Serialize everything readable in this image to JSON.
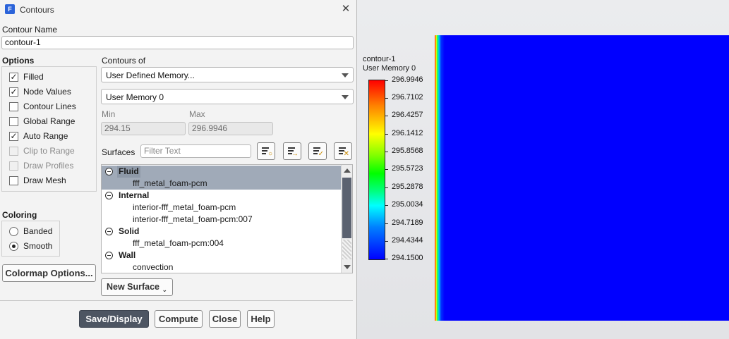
{
  "window": {
    "title": "Contours",
    "app_icon": "F"
  },
  "contour_name": {
    "label": "Contour Name",
    "value": "contour-1"
  },
  "options": {
    "title": "Options",
    "items": [
      {
        "label": "Filled",
        "checked": true,
        "enabled": true
      },
      {
        "label": "Node Values",
        "checked": true,
        "enabled": true
      },
      {
        "label": "Contour Lines",
        "checked": false,
        "enabled": true
      },
      {
        "label": "Global Range",
        "checked": false,
        "enabled": true
      },
      {
        "label": "Auto Range",
        "checked": true,
        "enabled": true
      },
      {
        "label": "Clip to Range",
        "checked": false,
        "enabled": false
      },
      {
        "label": "Draw Profiles",
        "checked": false,
        "enabled": false
      },
      {
        "label": "Draw Mesh",
        "checked": false,
        "enabled": true
      }
    ]
  },
  "contours_of": {
    "label": "Contours of",
    "primary": "User Defined Memory...",
    "secondary": "User Memory 0",
    "min_label": "Min",
    "max_label": "Max",
    "min_value": "294.15",
    "max_value": "296.9946"
  },
  "surfaces": {
    "label": "Surfaces",
    "filter_placeholder": "Filter Text",
    "groups": [
      {
        "name": "Fluid",
        "items": [
          "fff_metal_foam-pcm"
        ]
      },
      {
        "name": "Internal",
        "items": [
          "interior-fff_metal_foam-pcm",
          "interior-fff_metal_foam-pcm:007"
        ]
      },
      {
        "name": "Solid",
        "items": [
          "fff_metal_foam-pcm:004"
        ]
      },
      {
        "name": "Wall",
        "items": [
          "convection"
        ]
      }
    ]
  },
  "coloring": {
    "title": "Coloring",
    "options": [
      "Banded",
      "Smooth"
    ],
    "selected": "Smooth"
  },
  "buttons": {
    "colormap_options": "Colormap Options...",
    "new_surface": "New Surface",
    "save_display": "Save/Display",
    "compute": "Compute",
    "close": "Close",
    "help": "Help"
  },
  "icons": {
    "close": "close-icon",
    "surface_tools": [
      "select-surface-icon",
      "group-surfaces-icon",
      "select-all-icon",
      "deselect-all-icon"
    ]
  },
  "legend": {
    "name": "contour-1",
    "variable": "User Memory 0",
    "ticks": [
      "296.9946",
      "296.7102",
      "296.4257",
      "296.1412",
      "295.8568",
      "295.5723",
      "295.2878",
      "295.0034",
      "294.7189",
      "294.4344",
      "294.1500"
    ]
  },
  "colors": {
    "primary_button": "#4d5562",
    "selection": "#a0aab8",
    "field_low": "#0000ff",
    "field_high": "#ff0000"
  }
}
